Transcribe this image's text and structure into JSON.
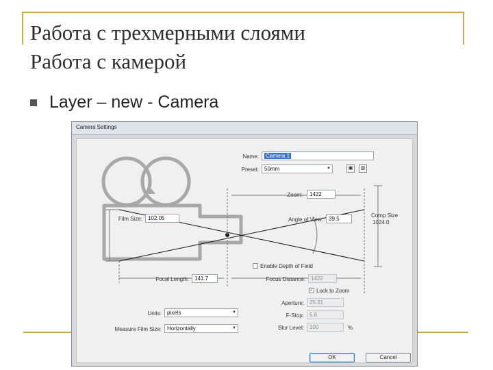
{
  "slide": {
    "title_line1": "Работа с трехмерными слоями",
    "title_line2": "Работа с камерой",
    "bullet": "Layer – new - Camera"
  },
  "dialog": {
    "title": "Camera Settings",
    "name_label": "Name:",
    "name_value": "Camera 1",
    "preset_label": "Preset:",
    "preset_value": "50mm",
    "zoom_label": "Zoom:",
    "zoom_value": "1422",
    "film_size_label": "Film Size:",
    "film_size_value": "102.05",
    "angle_label": "Angle of View:",
    "angle_value": "39.5",
    "comp_size_label": "Comp Size",
    "comp_size_value": "1024.0",
    "enable_dof_label": "Enable Depth of Field",
    "focal_length_label": "Focal Length:",
    "focal_length_value": "141.7",
    "focus_distance_label": "Focus Distance:",
    "focus_distance_value": "1422",
    "lock_to_zoom_label": "Lock to Zoom",
    "aperture_label": "Aperture:",
    "aperture_value": "25.31",
    "fstop_label": "F-Stop:",
    "fstop_value": "5.6",
    "blur_label": "Blur Level:",
    "blur_value": "100",
    "blur_unit": "%",
    "units_label": "Units:",
    "units_value": "pixels",
    "measure_label": "Measure Film Size:",
    "measure_value": "Horizontally",
    "ok_label": "OK",
    "cancel_label": "Cancel"
  },
  "icons": {
    "bullet": "square-bullet",
    "save_preset": "save-icon",
    "delete_preset": "trash-icon",
    "dropdown": "chevron-down-icon"
  },
  "colors": {
    "frame": "#c9a94e",
    "dialog_panel": "#f0f0f0",
    "camera_outline": "#a8a8a8",
    "selection": "#3e73c9"
  }
}
